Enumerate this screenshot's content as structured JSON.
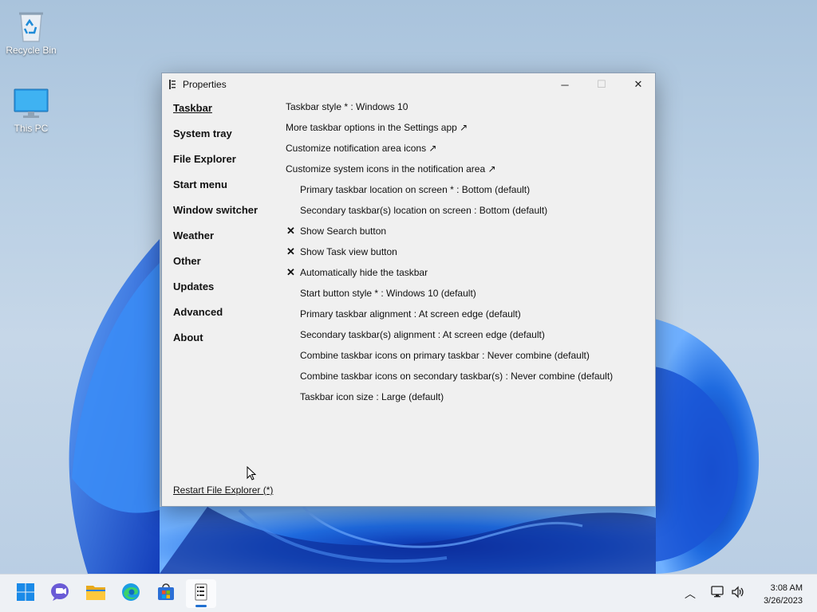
{
  "desktop": {
    "icons": [
      {
        "label": "Recycle Bin",
        "icon": "recycle-bin-icon"
      },
      {
        "label": "This PC",
        "icon": "monitor-icon"
      }
    ]
  },
  "window": {
    "title": "Properties",
    "controls": {
      "minimize": "─",
      "maximize": "☐",
      "close": "✕"
    }
  },
  "nav": {
    "items": [
      {
        "label": "Taskbar",
        "active": true
      },
      {
        "label": "System tray"
      },
      {
        "label": "File Explorer"
      },
      {
        "label": "Start menu"
      },
      {
        "label": "Window switcher"
      },
      {
        "label": "Weather"
      },
      {
        "label": "Other"
      },
      {
        "label": "Updates"
      },
      {
        "label": "Advanced"
      },
      {
        "label": "About"
      }
    ]
  },
  "settings": {
    "rows": [
      {
        "text": "Taskbar style * : Windows 10",
        "indent": false,
        "checked": false
      },
      {
        "text": "More taskbar options in the Settings app ↗",
        "indent": false,
        "checked": false
      },
      {
        "text": "Customize notification area icons ↗",
        "indent": false,
        "checked": false
      },
      {
        "text": "Customize system icons in the notification area ↗",
        "indent": false,
        "checked": false
      },
      {
        "text": "Primary taskbar location on screen * : Bottom (default)",
        "indent": true,
        "checked": false
      },
      {
        "text": "Secondary taskbar(s) location on screen : Bottom (default)",
        "indent": true,
        "checked": false
      },
      {
        "text": "Show Search button",
        "indent": true,
        "checked": true
      },
      {
        "text": "Show Task view button",
        "indent": true,
        "checked": true
      },
      {
        "text": "Automatically hide the taskbar",
        "indent": true,
        "checked": true
      },
      {
        "text": "Start button style * : Windows 10 (default)",
        "indent": true,
        "checked": false
      },
      {
        "text": "Primary taskbar alignment : At screen edge (default)",
        "indent": true,
        "checked": false
      },
      {
        "text": "Secondary taskbar(s) alignment : At screen edge (default)",
        "indent": true,
        "checked": false
      },
      {
        "text": "Combine taskbar icons on primary taskbar : Never combine (default)",
        "indent": true,
        "checked": false
      },
      {
        "text": "Combine taskbar icons on secondary taskbar(s) : Never combine (default)",
        "indent": true,
        "checked": false
      },
      {
        "text": "Taskbar icon size : Large (default)",
        "indent": true,
        "checked": false
      }
    ],
    "check_glyph": "✕"
  },
  "footer": {
    "restart_label": "Restart File Explorer (*)"
  },
  "taskbar": {
    "apps": [
      {
        "name": "start",
        "icon": "windows-start-icon"
      },
      {
        "name": "chat",
        "icon": "teams-chat-icon"
      },
      {
        "name": "file-explorer",
        "icon": "folder-icon"
      },
      {
        "name": "edge",
        "icon": "edge-browser-icon"
      },
      {
        "name": "store",
        "icon": "store-icon"
      },
      {
        "name": "properties",
        "icon": "properties-app-icon",
        "running": true
      }
    ],
    "tray": {
      "chevron": "︿"
    },
    "clock": {
      "time": "3:08 AM",
      "date": "3/26/2023"
    }
  },
  "colors": {
    "accent": "#1f6fd1",
    "window_bg": "#f0f0f0",
    "taskbar_bg": "#eef1f5"
  }
}
